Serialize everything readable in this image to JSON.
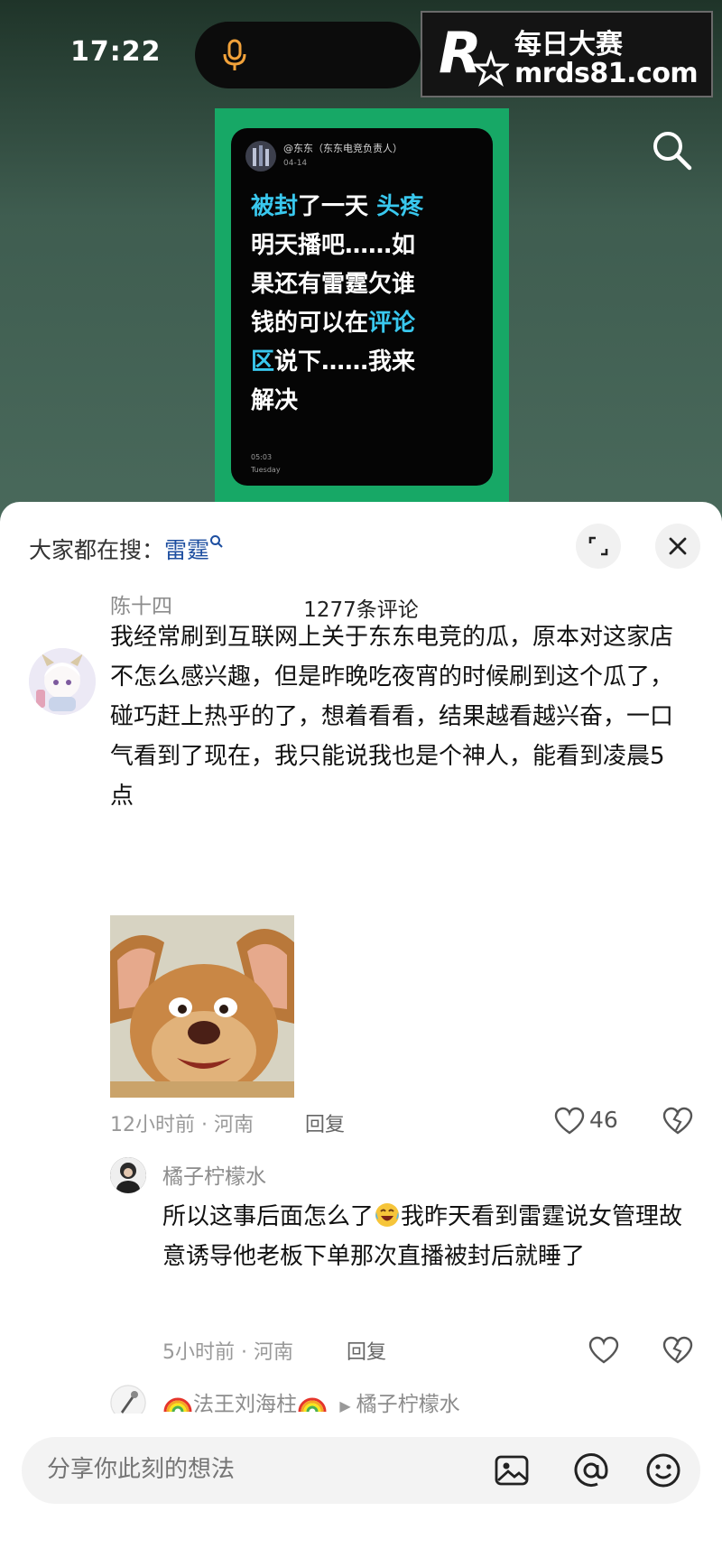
{
  "status_bar": {
    "time": "17:22"
  },
  "watermark": {
    "logo_letter": "R",
    "logo_small": "每日大赛",
    "name": "每日大赛",
    "url": "mrds81.com"
  },
  "post_image": {
    "author": "@东东（东东电竞负责人）",
    "date": "04-14",
    "text_parts": [
      "被封",
      "了一天 ",
      "头疼",
      "\n明天播吧……如\n果还有雷霆欠谁\n钱的可以在",
      "评论\n区",
      "说下……我来\n解决"
    ],
    "time": "05:03",
    "day": "Tuesday"
  },
  "sheet": {
    "search_prefix": "大家都在搜：",
    "search_keyword": "雷霆",
    "comment_count": "1277条评论"
  },
  "comments": [
    {
      "author": "陈十四",
      "text": "我经常刷到互联网上关于东东电竞的瓜，原本对这家店不怎么感兴趣，但是昨晚吃夜宵的时候刷到这个瓜了，碰巧赶上热乎的了，想着看看，结果越看越兴奋，一口气看到了现在，我只能说我也是个神人，能看到凌晨5点",
      "meta": "12小时前 · 河南",
      "reply_label": "回复",
      "likes": "46"
    }
  ],
  "replies": [
    {
      "author": "橘子柠檬水",
      "text_before": "所以这事后面怎么了",
      "text_after": "我昨天看到雷霆说女管理故意诱导他老板下单那次直播被封后就睡了",
      "meta": "5小时前 · 河南",
      "reply_label": "回复"
    },
    {
      "author": "法王刘海柱",
      "reply_to": "橘子柠檬水"
    }
  ],
  "input": {
    "placeholder": "分享你此刻的想法"
  },
  "icons": [
    "mic-icon",
    "search-icon",
    "expand-icon",
    "close-icon",
    "heart-icon",
    "dislike-icon",
    "image-icon",
    "at-icon",
    "emoji-icon"
  ],
  "colors": {
    "accent_blue": "#1d4ea0",
    "post_green": "#17a866",
    "highlight_cyan": "#39c8ee",
    "mic_orange": "#f2a23a"
  }
}
